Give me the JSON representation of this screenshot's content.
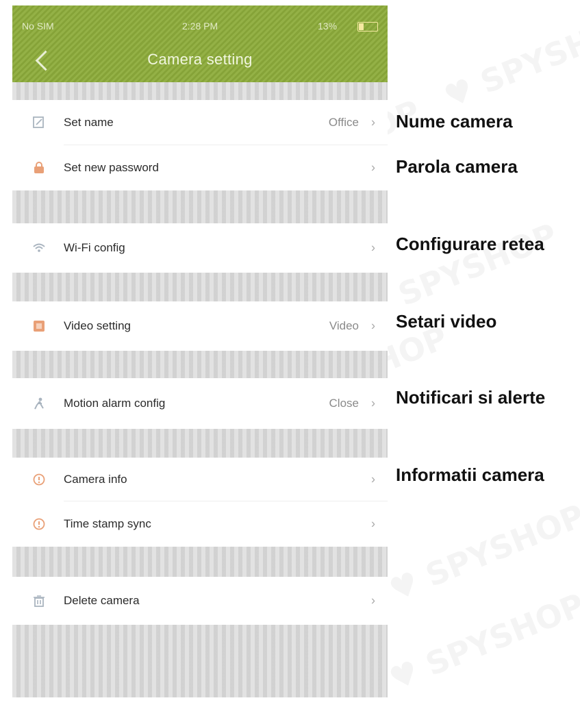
{
  "status_bar": {
    "carrier": "No SIM",
    "time": "2:28 PM",
    "battery": "13%"
  },
  "header": {
    "title": "Camera setting"
  },
  "settings": [
    {
      "label": "Set name",
      "value": "Office",
      "icon": "edit-icon"
    },
    {
      "label": "Set new password",
      "value": "",
      "icon": "lock-icon"
    },
    {
      "label": "Wi-Fi config",
      "value": "",
      "icon": "wifi-icon"
    },
    {
      "label": "Video setting",
      "value": "Video",
      "icon": "video-icon"
    },
    {
      "label": "Motion alarm config",
      "value": "Close",
      "icon": "motion-icon"
    },
    {
      "label": "Camera info",
      "value": "",
      "icon": "info-icon"
    },
    {
      "label": "Time stamp sync",
      "value": "",
      "icon": "clock-icon"
    },
    {
      "label": "Delete camera",
      "value": "",
      "icon": "trash-icon"
    }
  ],
  "annotations": [
    "Nume camera",
    "Parola camera",
    "Configurare retea",
    "Setari video",
    "Notificari si alerte",
    "Informatii camera"
  ],
  "colors": {
    "header": "#8dac3b",
    "icon_orange": "#e9a077",
    "icon_gray": "#a9b4bf"
  }
}
